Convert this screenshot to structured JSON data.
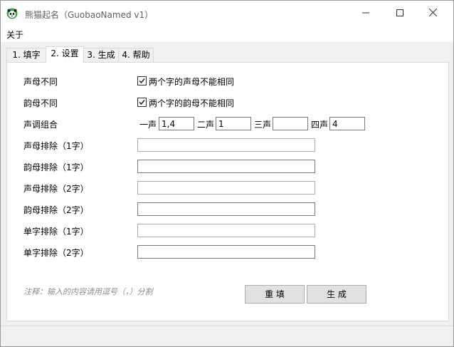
{
  "window": {
    "title": "熊猫起名（GuobaoNamed v1）",
    "icon": "panda-icon",
    "controls": [
      "minimize-icon",
      "maximize-icon",
      "close-icon"
    ]
  },
  "menubar": {
    "items": [
      {
        "label": "关于"
      }
    ]
  },
  "tabs": [
    {
      "label": "1. 填字",
      "active": false
    },
    {
      "label": "2. 设置",
      "active": true
    },
    {
      "label": "3. 生成",
      "active": false
    },
    {
      "label": "4. 帮助",
      "active": false
    }
  ],
  "settings": {
    "initial_diff": {
      "label": "声母不同",
      "checkbox_label": "两个字的声母不能相同",
      "checked": true
    },
    "final_diff": {
      "label": "韵母不同",
      "checkbox_label": "两个字的韵母不能相同",
      "checked": true
    },
    "tone_combo": {
      "label": "声调组合",
      "tones": [
        {
          "label": "一声",
          "value": "1,4"
        },
        {
          "label": "二声",
          "value": "1"
        },
        {
          "label": "三声",
          "value": ""
        },
        {
          "label": "四声",
          "value": "4"
        }
      ]
    },
    "exclusions": [
      {
        "label": "声母排除（1字）",
        "value": ""
      },
      {
        "label": "韵母排除（1字）",
        "value": ""
      },
      {
        "label": "声母排除（2字）",
        "value": ""
      },
      {
        "label": "韵母排除（2字）",
        "value": ""
      },
      {
        "label": "单字排除（1字）",
        "value": ""
      },
      {
        "label": "单字排除（2字）",
        "value": ""
      }
    ]
  },
  "note": "注释：输入的内容请用逗号（，）分割",
  "buttons": {
    "reset": "重 填",
    "generate": "生 成"
  }
}
